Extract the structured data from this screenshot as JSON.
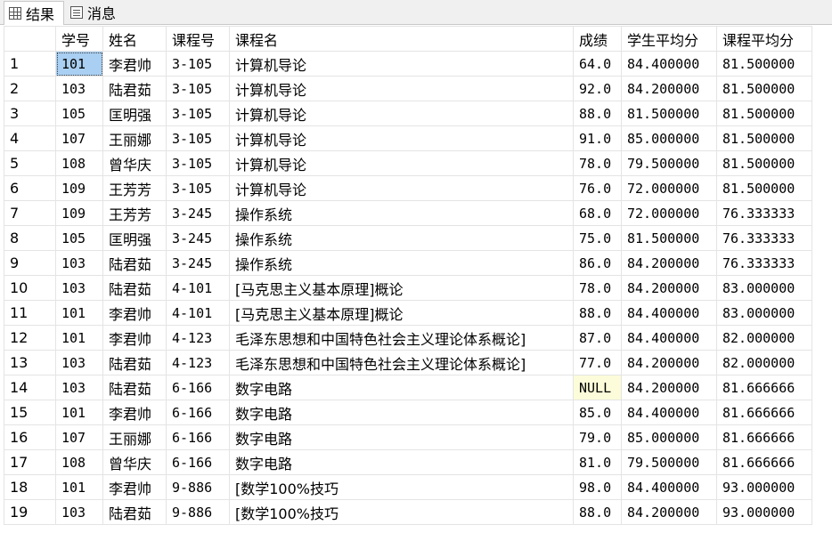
{
  "tabs": [
    {
      "label": "结果",
      "icon": "grid-icon"
    },
    {
      "label": "消息",
      "icon": "messages-icon"
    }
  ],
  "columns": [
    "",
    "学号",
    "姓名",
    "课程号",
    "课程名",
    "成绩",
    "学生平均分",
    "课程平均分"
  ],
  "rows": [
    [
      "1",
      "101",
      "李君帅",
      "3-105",
      "计算机导论",
      "64.0",
      "84.400000",
      "81.500000"
    ],
    [
      "2",
      "103",
      "陆君茹",
      "3-105",
      "计算机导论",
      "92.0",
      "84.200000",
      "81.500000"
    ],
    [
      "3",
      "105",
      "匡明强",
      "3-105",
      "计算机导论",
      "88.0",
      "81.500000",
      "81.500000"
    ],
    [
      "4",
      "107",
      "王丽娜",
      "3-105",
      "计算机导论",
      "91.0",
      "85.000000",
      "81.500000"
    ],
    [
      "5",
      "108",
      "曾华庆",
      "3-105",
      "计算机导论",
      "78.0",
      "79.500000",
      "81.500000"
    ],
    [
      "6",
      "109",
      "王芳芳",
      "3-105",
      "计算机导论",
      "76.0",
      "72.000000",
      "81.500000"
    ],
    [
      "7",
      "109",
      "王芳芳",
      "3-245",
      "操作系统",
      "68.0",
      "72.000000",
      "76.333333"
    ],
    [
      "8",
      "105",
      "匡明强",
      "3-245",
      "操作系统",
      "75.0",
      "81.500000",
      "76.333333"
    ],
    [
      "9",
      "103",
      "陆君茹",
      "3-245",
      "操作系统",
      "86.0",
      "84.200000",
      "76.333333"
    ],
    [
      "10",
      "103",
      "陆君茹",
      "4-101",
      "[马克思主义基本原理]概论",
      "78.0",
      "84.200000",
      "83.000000"
    ],
    [
      "11",
      "101",
      "李君帅",
      "4-101",
      "[马克思主义基本原理]概论",
      "88.0",
      "84.400000",
      "83.000000"
    ],
    [
      "12",
      "101",
      "李君帅",
      "4-123",
      "毛泽东思想和中国特色社会主义理论体系概论]",
      "87.0",
      "84.400000",
      "82.000000"
    ],
    [
      "13",
      "103",
      "陆君茹",
      "4-123",
      "毛泽东思想和中国特色社会主义理论体系概论]",
      "77.0",
      "84.200000",
      "82.000000"
    ],
    [
      "14",
      "103",
      "陆君茹",
      "6-166",
      "数字电路",
      "NULL",
      "84.200000",
      "81.666666"
    ],
    [
      "15",
      "101",
      "李君帅",
      "6-166",
      "数字电路",
      "85.0",
      "84.400000",
      "81.666666"
    ],
    [
      "16",
      "107",
      "王丽娜",
      "6-166",
      "数字电路",
      "79.0",
      "85.000000",
      "81.666666"
    ],
    [
      "17",
      "108",
      "曾华庆",
      "6-166",
      "数字电路",
      "81.0",
      "79.500000",
      "81.666666"
    ],
    [
      "18",
      "101",
      "李君帅",
      "9-886",
      "[数学100%技巧",
      "98.0",
      "84.400000",
      "93.000000"
    ],
    [
      "19",
      "103",
      "陆君茹",
      "9-886",
      "[数学100%技巧",
      "88.0",
      "84.200000",
      "93.000000"
    ]
  ],
  "selected_cell": {
    "row": 1,
    "column": "学号"
  },
  "null_text": "NULL",
  "colors": {
    "selected": "#a9cff2",
    "null_cell": "#fcfcda",
    "grid_line": "#e4e4e4"
  }
}
